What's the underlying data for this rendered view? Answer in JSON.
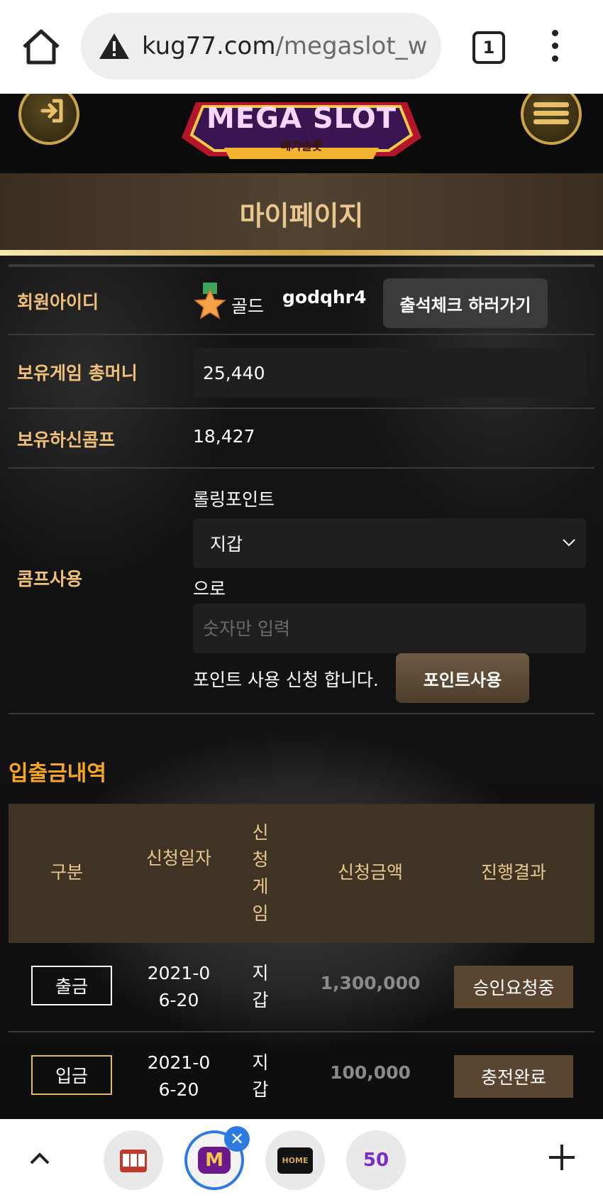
{
  "browser": {
    "url_domain": "kug77.com",
    "url_path": "/megaslot_w",
    "tab_count": "1"
  },
  "header": {
    "logo_main": "MEGA SLOT",
    "logo_sub": "메가슬롯"
  },
  "page_title": "마이페이지",
  "member": {
    "id_label": "회원아이디",
    "grade": "골드",
    "user_id": "godqhr4",
    "attendance_button": "출석체크 하러가기",
    "money_label": "보유게임 총머니",
    "money_value": "25,440",
    "comp_label": "보유하신콤프",
    "comp_value": "18,427"
  },
  "comp_use": {
    "label": "콤프사용",
    "rolling_label": "롤링포인트",
    "wallet_selected": "지갑",
    "to_label": "으로",
    "amount_placeholder": "숫자만 입력",
    "apply_text": "포인트 사용 신청 합니다.",
    "apply_button": "포인트사용"
  },
  "history": {
    "title": "입출금내역",
    "columns": [
      "구분",
      "신청일자",
      "신청게임",
      "신청금액",
      "진행결과"
    ],
    "rows": [
      {
        "type": "출금",
        "date": "2021-06-20",
        "game": "지갑",
        "amount": "1,300,000",
        "status": "승인요청중"
      },
      {
        "type": "입금",
        "date": "2021-06-20",
        "game": "지갑",
        "amount": "100,000",
        "status": "충전완료"
      }
    ]
  },
  "bottom_bar": {
    "shortcut_home_label": "HOME",
    "shortcut_m_label": "M",
    "shortcut_50_label": "50"
  },
  "colors": {
    "accent_gold": "#f0c07a",
    "section_orange": "#f6a623",
    "title_bar": "#524231",
    "status_brown": "#5a4530",
    "chrome_blue": "#2d7be0"
  }
}
